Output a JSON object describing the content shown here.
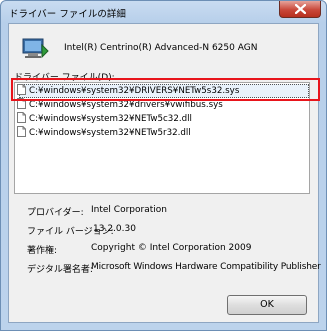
{
  "window": {
    "title": "ドライバー ファイルの詳細"
  },
  "device": {
    "name": "Intel(R) Centrino(R) Advanced-N 6250 AGN"
  },
  "files": {
    "label": "ドライバー ファイル(D):",
    "items": [
      "C:¥windows¥system32¥DRIVERS¥NETw5s32.sys",
      "C:¥windows¥system32¥drivers¥vwifibus.sys",
      "C:¥windows¥system32¥NETw5c32.dll",
      "C:¥windows¥system32¥NETw5r32.dll"
    ]
  },
  "properties": {
    "provider": {
      "label": "プロバイダー:",
      "value": "Intel Corporation"
    },
    "version": {
      "label": "ファイル バージョン:",
      "value": "13.2.0.30"
    },
    "copyright": {
      "label": "著作権:",
      "value": "Copyright © Intel Corporation 2009"
    },
    "signer": {
      "label": "デジタル署名者:",
      "value": "Microsoft Windows Hardware Compatibility Publisher"
    }
  },
  "buttons": {
    "ok": "OK"
  }
}
